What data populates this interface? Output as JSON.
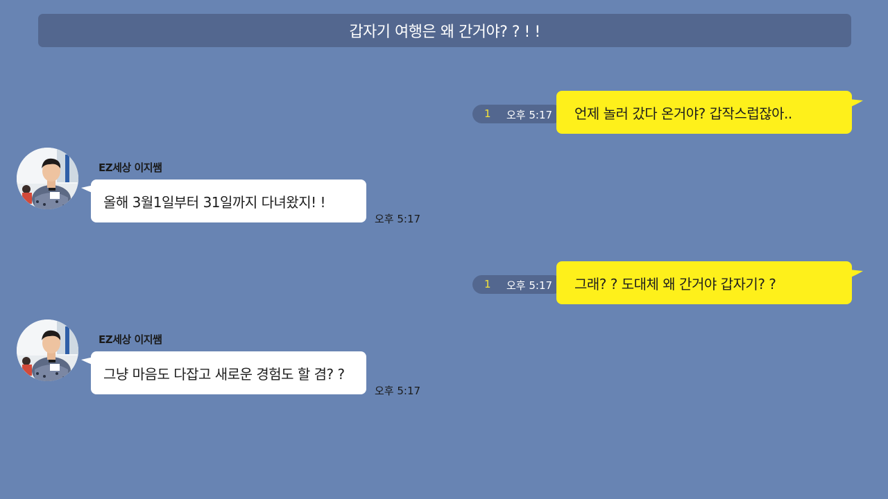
{
  "header": {
    "title": "갑자기 여행은 왜 간거야? ? ! !"
  },
  "colors": {
    "background": "#6884b3",
    "header_bg": "#53678f",
    "my_bubble": "#fef01b",
    "other_bubble": "#ffffff",
    "unread_count": "#f3e23a"
  },
  "messages": [
    {
      "from": "me",
      "text": "언제 놀러 갔다 온거야?  갑작스럽잖아..",
      "time": "오후 5:17",
      "unread": "1"
    },
    {
      "from": "other",
      "sender": "EZ세상 이지쌤",
      "avatar_icon": "profile-photo",
      "text": "올해 3월1일부터 31일까지 다녀왔지! !",
      "time": "오후 5:17"
    },
    {
      "from": "me",
      "text": "그래? ?  도대체 왜 간거야 갑자기? ?",
      "time": "오후 5:17",
      "unread": "1"
    },
    {
      "from": "other",
      "sender": "EZ세상 이지쌤",
      "avatar_icon": "profile-photo",
      "text": "그냥 마음도 다잡고 새로운 경험도 할 겸? ?",
      "time": "오후 5:17"
    }
  ]
}
